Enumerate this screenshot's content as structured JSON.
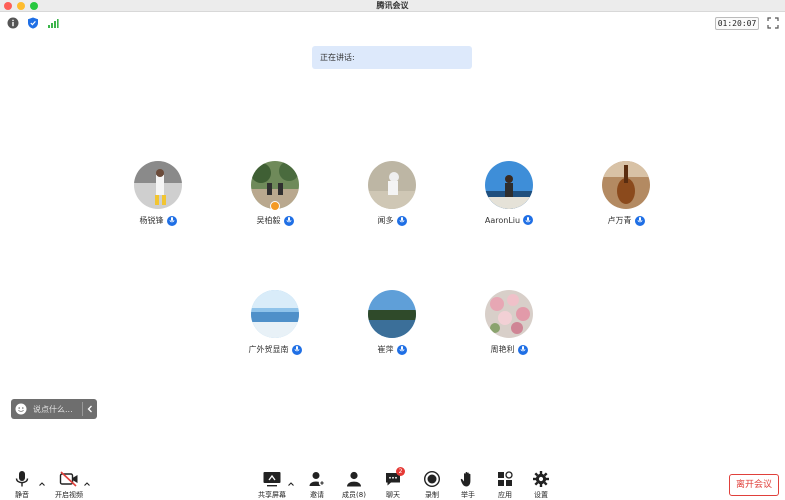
{
  "window": {
    "title": "腾讯会议"
  },
  "toolbar": {
    "timer": "01:20:07"
  },
  "speaking": {
    "label": "正在讲话:"
  },
  "participants": [
    {
      "name": "杨锐锋",
      "host": false
    },
    {
      "name": "吴柏毅",
      "host": true
    },
    {
      "name": "闻多",
      "host": false
    },
    {
      "name": "AaronLiu",
      "host": false
    },
    {
      "name": "卢万青",
      "host": false
    },
    {
      "name": "广外贺显南",
      "host": false
    },
    {
      "name": "崔萍",
      "host": false
    },
    {
      "name": "周艳利",
      "host": false
    }
  ],
  "chat": {
    "placeholder": "说点什么..."
  },
  "bottom": {
    "mute": "静音",
    "video": "开启视频",
    "share": "共享屏幕",
    "invite": "邀请",
    "members": "成员(8)",
    "chat": "聊天",
    "chat_badge": "2",
    "record": "录制",
    "raise_hand": "举手",
    "apps": "应用",
    "settings": "设置",
    "leave": "离开会议"
  },
  "colors": {
    "accent": "#1f6fe5",
    "danger": "#e0403b",
    "speaking_bg": "#dde9fb"
  }
}
